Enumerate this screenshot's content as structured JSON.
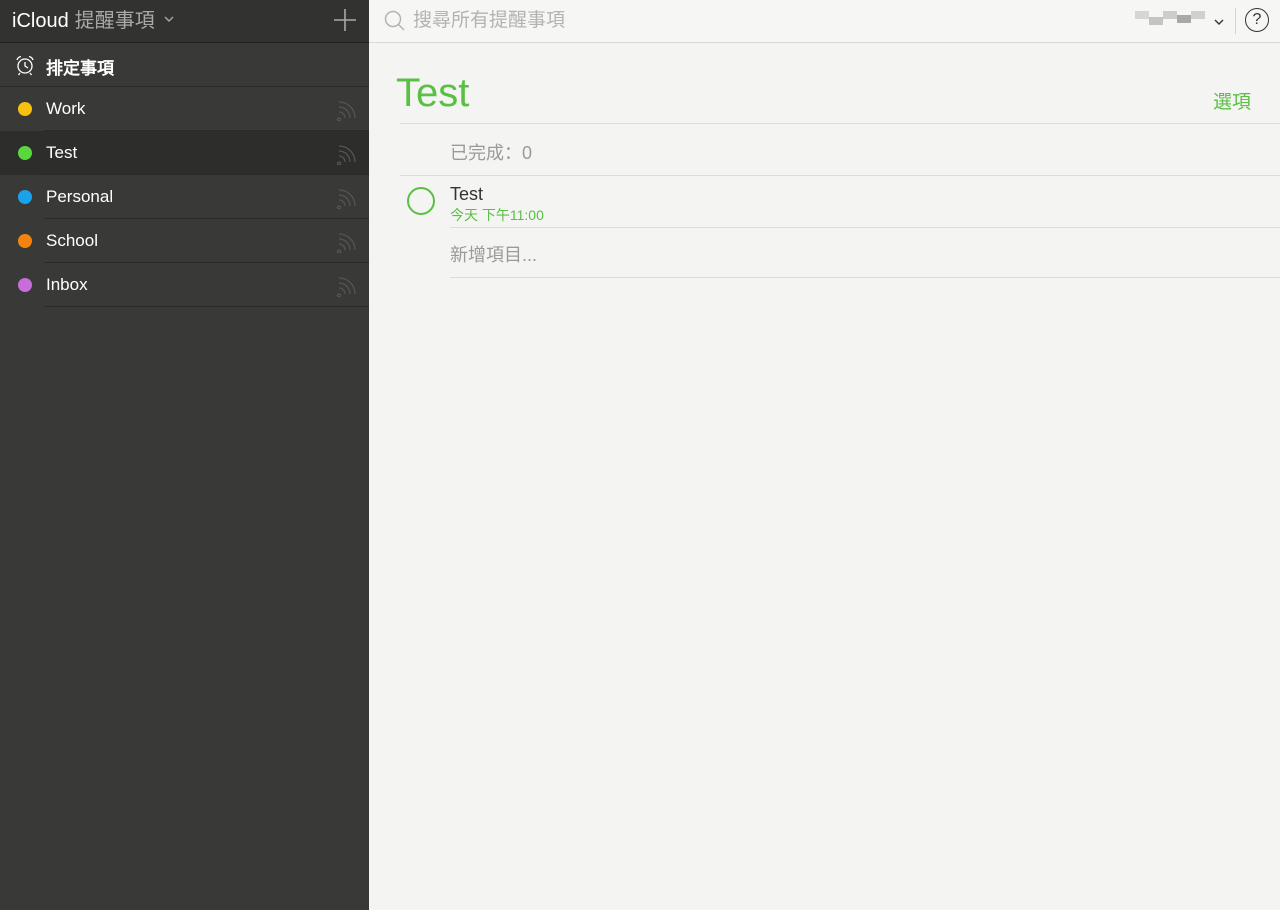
{
  "sidebar": {
    "brand": "iCloud",
    "app_name": "提醒事項",
    "add_button_icon": "plus-icon",
    "scheduled": {
      "label": "排定事項",
      "icon": "alarm-clock-icon"
    },
    "lists": [
      {
        "label": "Work",
        "color": "#f7c10f",
        "selected": false
      },
      {
        "label": "Test",
        "color": "#5ad63f",
        "selected": true
      },
      {
        "label": "Personal",
        "color": "#1aa2ea",
        "selected": false
      },
      {
        "label": "School",
        "color": "#f5830d",
        "selected": false
      },
      {
        "label": "Inbox",
        "color": "#c86ddb",
        "selected": false
      }
    ]
  },
  "topbar": {
    "search_placeholder": "搜尋所有提醒事項",
    "account_icon": "account-menu",
    "help_label": "?"
  },
  "main": {
    "title": "Test",
    "options_label": "選項",
    "completed_label": "已完成：0",
    "tasks": [
      {
        "title": "Test",
        "due": "今天 下午11:00"
      }
    ],
    "new_item_placeholder": "新增項目..."
  },
  "colors": {
    "accent": "#5ac043",
    "sidebar_bg": "#393937",
    "content_bg": "#f4f4f2"
  }
}
